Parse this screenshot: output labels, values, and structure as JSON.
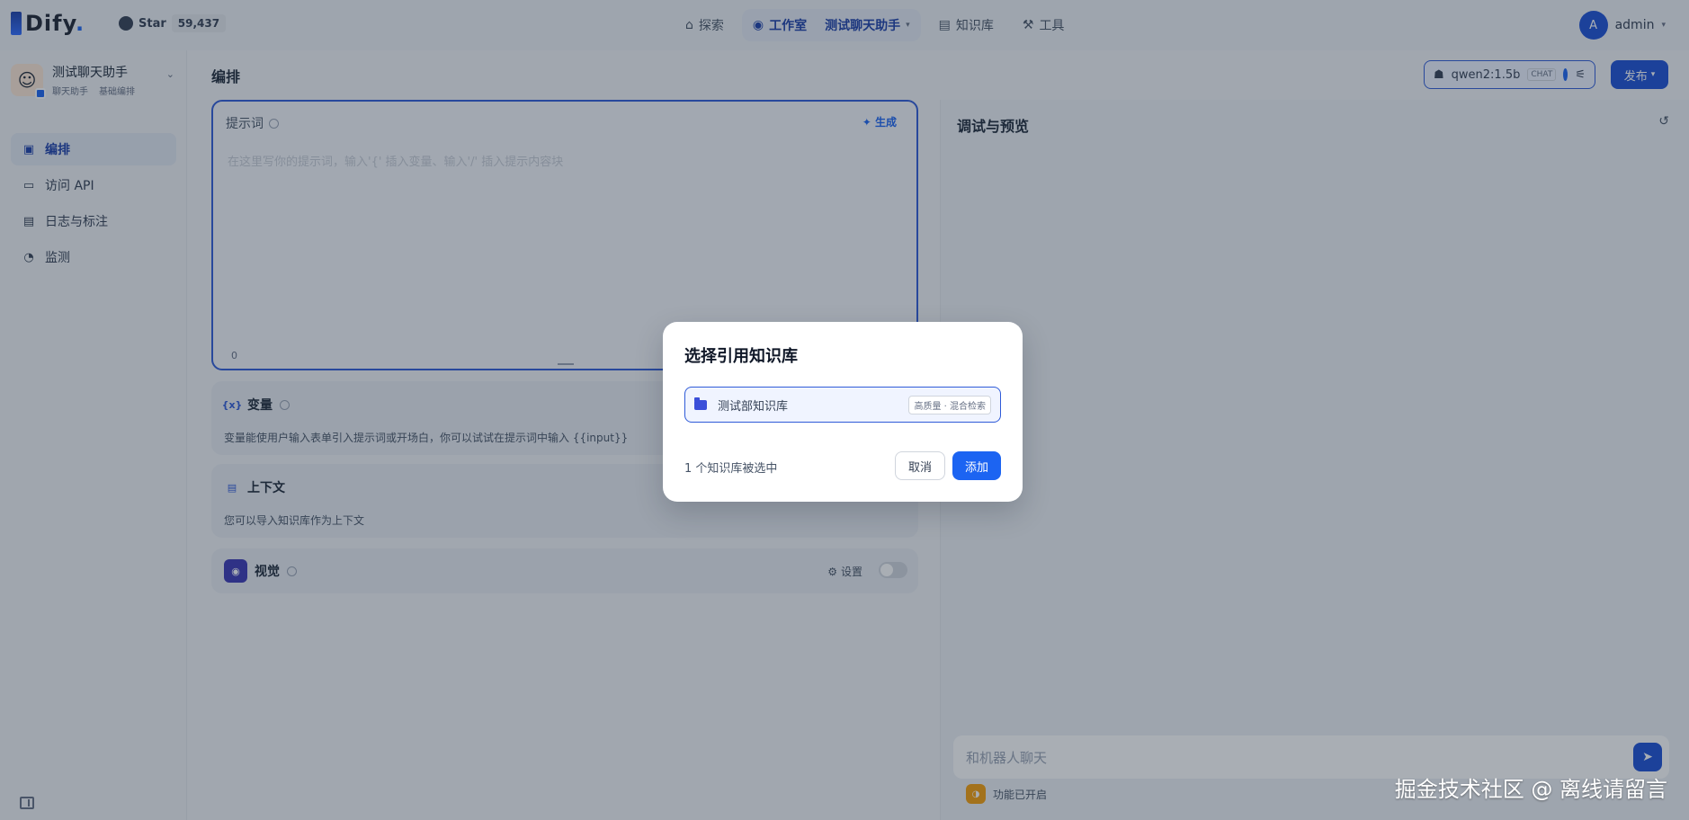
{
  "header": {
    "logo_text": "Dify",
    "github_label": "Star",
    "github_count": "59,437",
    "nav": [
      {
        "label": "探索",
        "icon": "explore-icon"
      },
      {
        "label": "工作室",
        "icon": "robot-icon",
        "app_name": "测试聊天助手"
      },
      {
        "label": "知识库",
        "icon": "book-icon"
      },
      {
        "label": "工具",
        "icon": "hammer-icon"
      }
    ],
    "user": {
      "initial": "A",
      "name": "admin"
    }
  },
  "sidebar": {
    "app_name": "测试聊天助手",
    "app_type": "聊天助手",
    "app_mode": "基础编排",
    "items": [
      {
        "label": "编排",
        "icon": "layout-icon"
      },
      {
        "label": "访问 API",
        "icon": "terminal-icon"
      },
      {
        "label": "日志与标注",
        "icon": "file-icon"
      },
      {
        "label": "监测",
        "icon": "monitor-icon"
      }
    ]
  },
  "main": {
    "title": "编排",
    "model_name": "qwen2:1.5b",
    "model_mode": "CHAT",
    "publish_label": "发布",
    "prompt": {
      "title": "提示词",
      "generate_label": "生成",
      "placeholder": "在这里写你的提示词，输入'{' 插入变量、输入'/' 插入提示内容块",
      "count": "0"
    },
    "variables": {
      "title": "变量",
      "desc": "变量能使用户输入表单引入提示词或开场白，你可以试试在提示词中输入 {{input}}"
    },
    "context": {
      "title": "上下文",
      "desc": "您可以导入知识库作为上下文"
    },
    "vision": {
      "title": "视觉",
      "settings_label": "设置"
    }
  },
  "debug": {
    "title": "调试与预览",
    "input_placeholder": "和机器人聊天",
    "feature_label": "功能已开启"
  },
  "modal": {
    "title": "选择引用知识库",
    "kb_name": "测试部知识库",
    "kb_tag": "高质量 · 混合检索",
    "selected_text": "1 个知识库被选中",
    "cancel_label": "取消",
    "add_label": "添加"
  },
  "watermark": "掘金技术社区 @ 离线请留言",
  "colors": {
    "accent": "#1c64f2",
    "brand": "#1c3faa"
  }
}
